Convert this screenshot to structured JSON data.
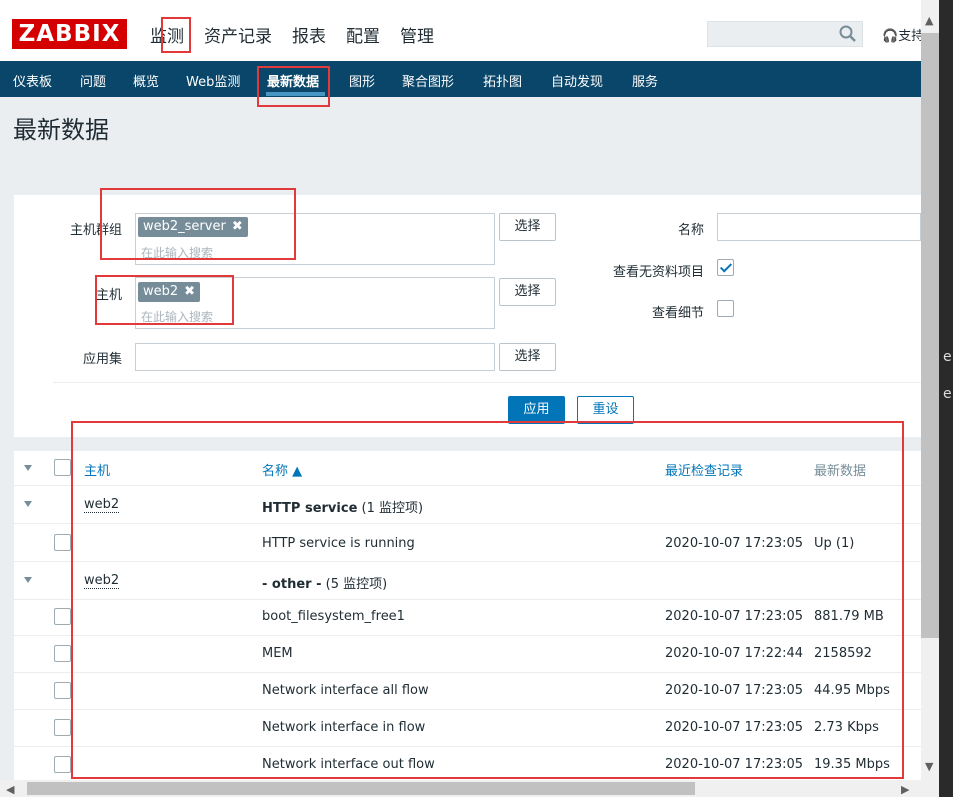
{
  "header": {
    "logo": "ZABBIX",
    "menu": [
      "监测",
      "资产记录",
      "报表",
      "配置",
      "管理"
    ],
    "support": "支持"
  },
  "subnav": {
    "items": [
      "仪表板",
      "问题",
      "概览",
      "Web监测",
      "最新数据",
      "图形",
      "聚合图形",
      "拓扑图",
      "自动发现",
      "服务"
    ],
    "active": "最新数据"
  },
  "page_title": "最新数据",
  "filter": {
    "host_group_label": "主机群组",
    "host_group_chip": "web2_server",
    "host_label": "主机",
    "host_chip": "web2",
    "app_label": "应用集",
    "placeholder": "在此输入搜索",
    "select_button": "选择",
    "name_label": "名称",
    "show_no_data_label": "查看无资料项目",
    "show_no_data_checked": true,
    "show_details_label": "查看细节",
    "show_details_checked": false,
    "apply_button": "应用",
    "reset_button": "重设"
  },
  "table": {
    "columns": {
      "host": "主机",
      "name": "名称 ▲",
      "last_check": "最近检查记录",
      "last_value": "最新数据"
    },
    "groups": [
      {
        "host": "web2",
        "app": "HTTP service",
        "count": "(1 监控项)"
      },
      {
        "host": "web2",
        "app": "- other -",
        "count": "(5 监控项)"
      }
    ],
    "rows": [
      {
        "name": "HTTP service is running",
        "last_check": "2020-10-07 17:23:05",
        "last_value": "Up (1)"
      },
      {
        "name": "boot_filesystem_free1",
        "last_check": "2020-10-07 17:23:05",
        "last_value": "881.79 MB"
      },
      {
        "name": "MEM",
        "last_check": "2020-10-07 17:22:44",
        "last_value": "2158592"
      },
      {
        "name": "Network interface all flow",
        "last_check": "2020-10-07 17:23:05",
        "last_value": "44.95 Mbps"
      },
      {
        "name": "Network interface in flow",
        "last_check": "2020-10-07 17:23:05",
        "last_value": "2.73 Kbps"
      },
      {
        "name": "Network interface out flow",
        "last_check": "2020-10-07 17:23:05",
        "last_value": "19.35 Mbps"
      }
    ]
  },
  "right_edge_chars": [
    "e",
    "e"
  ]
}
